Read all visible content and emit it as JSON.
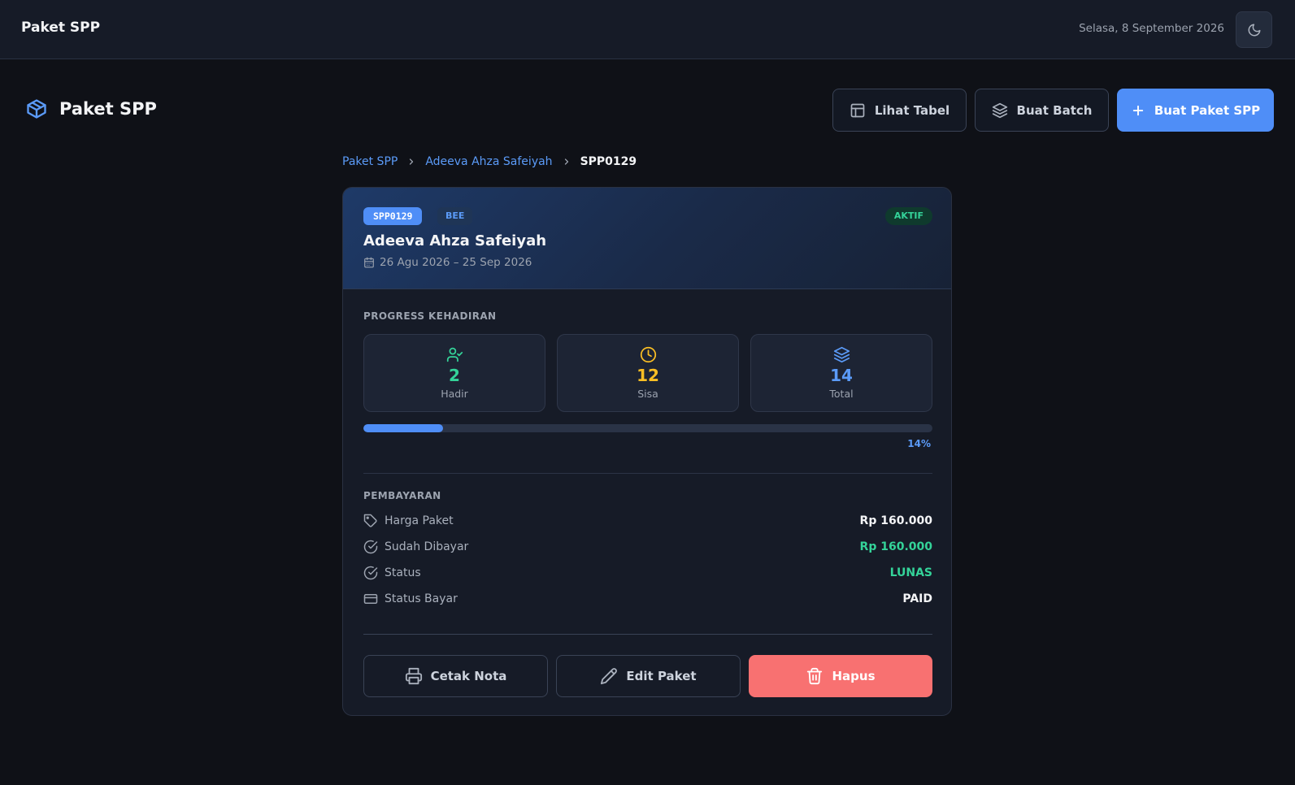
{
  "topbar": {
    "title": "Paket SPP",
    "date": "Selasa, 8 September 2026",
    "theme_toggle_icon": "moon-icon"
  },
  "header": {
    "title": "Paket SPP",
    "icon": "package-icon",
    "buttons": {
      "view_table": "Lihat Tabel",
      "create_batch": "Buat Batch",
      "create_package": "Buat Paket SPP"
    }
  },
  "breadcrumb": {
    "root": "Paket SPP",
    "student": "Adeeva Ahza Safeiyah",
    "current": "SPP0129"
  },
  "card": {
    "code": "SPP0129",
    "class": "BEE",
    "status": "AKTIF",
    "student_name": "Adeeva Ahza Safeiyah",
    "date_range": "26 Agu 2026 – 25 Sep 2026",
    "attendance": {
      "section_label": "PROGRESS KEHADIRAN",
      "present": {
        "value": "2",
        "label": "Hadir"
      },
      "remaining": {
        "value": "12",
        "label": "Sisa"
      },
      "total": {
        "value": "14",
        "label": "Total"
      },
      "progress_fraction": 0.14,
      "progress_label": "14%"
    },
    "payment": {
      "section_label": "PEMBAYARAN",
      "rows": [
        {
          "label": "Harga Paket",
          "value": "Rp 160.000"
        },
        {
          "label": "Sudah Dibayar",
          "value": "Rp 160.000"
        },
        {
          "label": "Status",
          "value": "LUNAS"
        },
        {
          "label": "Status Bayar",
          "value": "PAID"
        }
      ]
    },
    "actions": {
      "print": "Cetak Nota",
      "edit": "Edit Paket",
      "delete": "Hapus"
    }
  },
  "colors": {
    "accent": "#4f8ef7",
    "success": "#34d399",
    "warning": "#fbbf24",
    "danger": "#f87171"
  }
}
